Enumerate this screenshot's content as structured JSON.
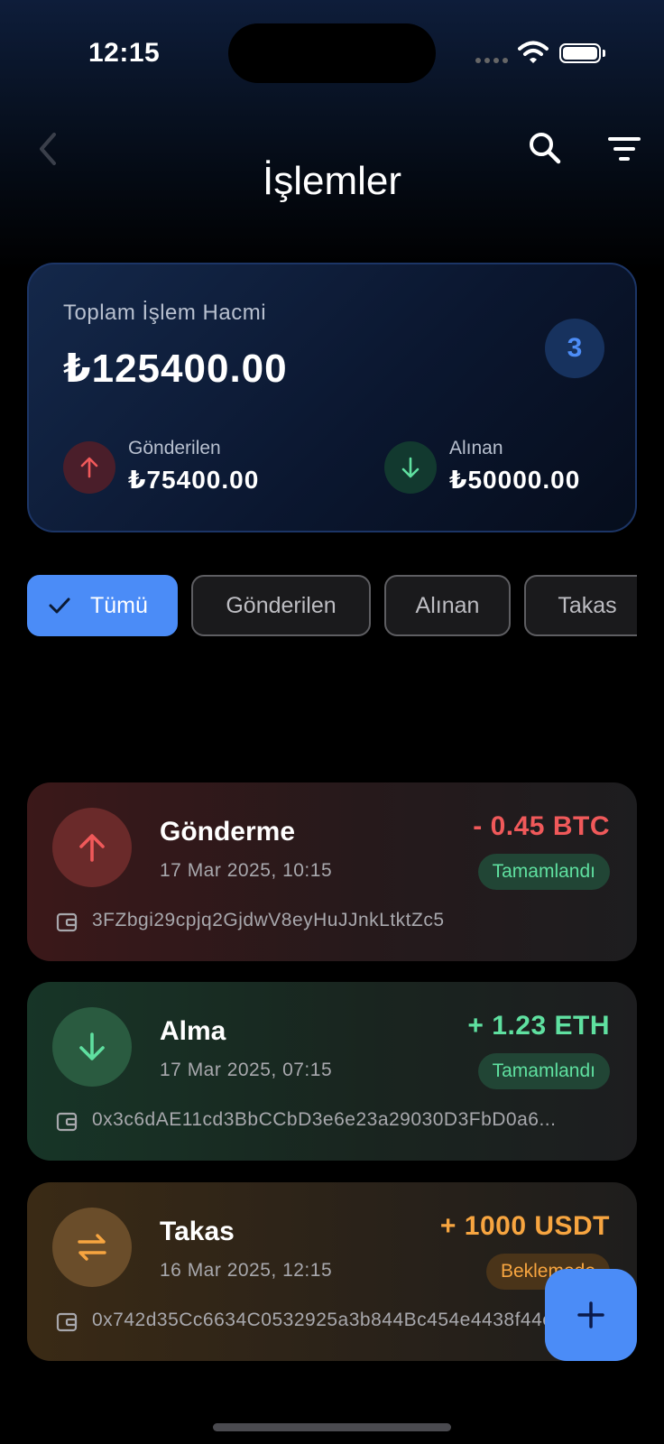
{
  "status_bar": {
    "time": "12:15"
  },
  "header": {
    "title": "İşlemler"
  },
  "summary": {
    "label": "Toplam İşlem Hacmi",
    "total": "₺125400.00",
    "count": "3",
    "sent_label": "Gönderilen",
    "sent_value": "₺75400.00",
    "received_label": "Alınan",
    "received_value": "₺50000.00"
  },
  "filters": {
    "all": "Tümü",
    "sent": "Gönderilen",
    "received": "Alınan",
    "swap": "Takas",
    "selected": "Tümü"
  },
  "transactions": [
    {
      "title": "Gönderme",
      "date": "17 Mar 2025, 10:15",
      "amount": "- 0.45 BTC",
      "status": "Tamamlandı",
      "address": "3FZbgi29cpjq2GjdwV8eyHuJJnkLtktZc5"
    },
    {
      "title": "Alma",
      "date": "17 Mar 2025, 07:15",
      "amount": "+ 1.23 ETH",
      "status": "Tamamlandı",
      "address": "0x3c6dAE11cd3BbCCbD3e6e23a29030D3FbD0a6..."
    },
    {
      "title": "Takas",
      "date": "16 Mar 2025, 12:15",
      "amount": "+ 1000 USDT",
      "status": "Beklemede",
      "address": "0x742d35Cc6634C0532925a3b844Bc454e4438f44e"
    }
  ],
  "colors": {
    "accent": "#4b8cf7",
    "sent": "#f0595a",
    "received": "#5fe0a0",
    "pending": "#f7a540"
  },
  "icons": {
    "back": "chevron-left-icon",
    "search": "search-icon",
    "filter": "filter-icon",
    "sent": "arrow-up-icon",
    "received": "arrow-down-icon",
    "swap": "swap-icon",
    "wallet": "wallet-icon",
    "check": "check-icon",
    "add": "plus-icon"
  }
}
